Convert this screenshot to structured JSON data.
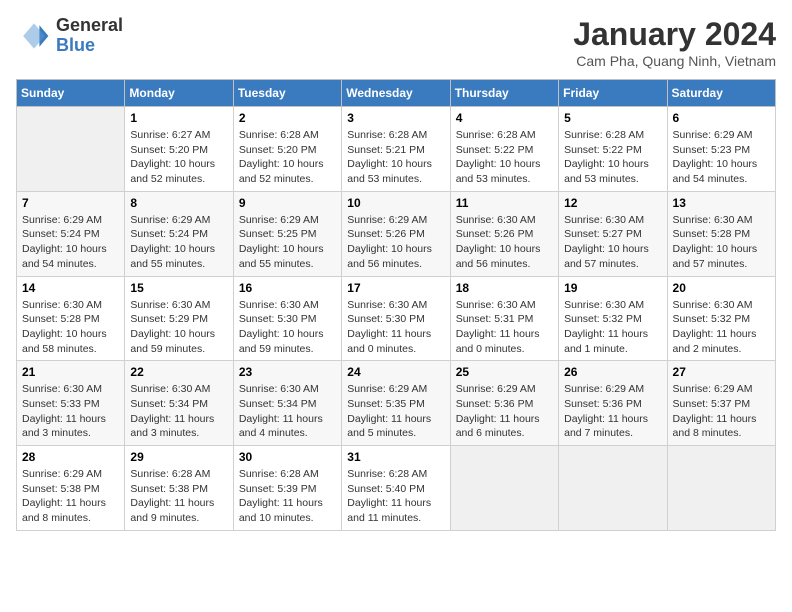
{
  "header": {
    "logo_text_general": "General",
    "logo_text_blue": "Blue",
    "month_title": "January 2024",
    "location": "Cam Pha, Quang Ninh, Vietnam"
  },
  "days_of_week": [
    "Sunday",
    "Monday",
    "Tuesday",
    "Wednesday",
    "Thursday",
    "Friday",
    "Saturday"
  ],
  "weeks": [
    [
      {
        "num": "",
        "info": ""
      },
      {
        "num": "1",
        "info": "Sunrise: 6:27 AM\nSunset: 5:20 PM\nDaylight: 10 hours\nand 52 minutes."
      },
      {
        "num": "2",
        "info": "Sunrise: 6:28 AM\nSunset: 5:20 PM\nDaylight: 10 hours\nand 52 minutes."
      },
      {
        "num": "3",
        "info": "Sunrise: 6:28 AM\nSunset: 5:21 PM\nDaylight: 10 hours\nand 53 minutes."
      },
      {
        "num": "4",
        "info": "Sunrise: 6:28 AM\nSunset: 5:22 PM\nDaylight: 10 hours\nand 53 minutes."
      },
      {
        "num": "5",
        "info": "Sunrise: 6:28 AM\nSunset: 5:22 PM\nDaylight: 10 hours\nand 53 minutes."
      },
      {
        "num": "6",
        "info": "Sunrise: 6:29 AM\nSunset: 5:23 PM\nDaylight: 10 hours\nand 54 minutes."
      }
    ],
    [
      {
        "num": "7",
        "info": "Sunrise: 6:29 AM\nSunset: 5:24 PM\nDaylight: 10 hours\nand 54 minutes."
      },
      {
        "num": "8",
        "info": "Sunrise: 6:29 AM\nSunset: 5:24 PM\nDaylight: 10 hours\nand 55 minutes."
      },
      {
        "num": "9",
        "info": "Sunrise: 6:29 AM\nSunset: 5:25 PM\nDaylight: 10 hours\nand 55 minutes."
      },
      {
        "num": "10",
        "info": "Sunrise: 6:29 AM\nSunset: 5:26 PM\nDaylight: 10 hours\nand 56 minutes."
      },
      {
        "num": "11",
        "info": "Sunrise: 6:30 AM\nSunset: 5:26 PM\nDaylight: 10 hours\nand 56 minutes."
      },
      {
        "num": "12",
        "info": "Sunrise: 6:30 AM\nSunset: 5:27 PM\nDaylight: 10 hours\nand 57 minutes."
      },
      {
        "num": "13",
        "info": "Sunrise: 6:30 AM\nSunset: 5:28 PM\nDaylight: 10 hours\nand 57 minutes."
      }
    ],
    [
      {
        "num": "14",
        "info": "Sunrise: 6:30 AM\nSunset: 5:28 PM\nDaylight: 10 hours\nand 58 minutes."
      },
      {
        "num": "15",
        "info": "Sunrise: 6:30 AM\nSunset: 5:29 PM\nDaylight: 10 hours\nand 59 minutes."
      },
      {
        "num": "16",
        "info": "Sunrise: 6:30 AM\nSunset: 5:30 PM\nDaylight: 10 hours\nand 59 minutes."
      },
      {
        "num": "17",
        "info": "Sunrise: 6:30 AM\nSunset: 5:30 PM\nDaylight: 11 hours\nand 0 minutes."
      },
      {
        "num": "18",
        "info": "Sunrise: 6:30 AM\nSunset: 5:31 PM\nDaylight: 11 hours\nand 0 minutes."
      },
      {
        "num": "19",
        "info": "Sunrise: 6:30 AM\nSunset: 5:32 PM\nDaylight: 11 hours\nand 1 minute."
      },
      {
        "num": "20",
        "info": "Sunrise: 6:30 AM\nSunset: 5:32 PM\nDaylight: 11 hours\nand 2 minutes."
      }
    ],
    [
      {
        "num": "21",
        "info": "Sunrise: 6:30 AM\nSunset: 5:33 PM\nDaylight: 11 hours\nand 3 minutes."
      },
      {
        "num": "22",
        "info": "Sunrise: 6:30 AM\nSunset: 5:34 PM\nDaylight: 11 hours\nand 3 minutes."
      },
      {
        "num": "23",
        "info": "Sunrise: 6:30 AM\nSunset: 5:34 PM\nDaylight: 11 hours\nand 4 minutes."
      },
      {
        "num": "24",
        "info": "Sunrise: 6:29 AM\nSunset: 5:35 PM\nDaylight: 11 hours\nand 5 minutes."
      },
      {
        "num": "25",
        "info": "Sunrise: 6:29 AM\nSunset: 5:36 PM\nDaylight: 11 hours\nand 6 minutes."
      },
      {
        "num": "26",
        "info": "Sunrise: 6:29 AM\nSunset: 5:36 PM\nDaylight: 11 hours\nand 7 minutes."
      },
      {
        "num": "27",
        "info": "Sunrise: 6:29 AM\nSunset: 5:37 PM\nDaylight: 11 hours\nand 8 minutes."
      }
    ],
    [
      {
        "num": "28",
        "info": "Sunrise: 6:29 AM\nSunset: 5:38 PM\nDaylight: 11 hours\nand 8 minutes."
      },
      {
        "num": "29",
        "info": "Sunrise: 6:28 AM\nSunset: 5:38 PM\nDaylight: 11 hours\nand 9 minutes."
      },
      {
        "num": "30",
        "info": "Sunrise: 6:28 AM\nSunset: 5:39 PM\nDaylight: 11 hours\nand 10 minutes."
      },
      {
        "num": "31",
        "info": "Sunrise: 6:28 AM\nSunset: 5:40 PM\nDaylight: 11 hours\nand 11 minutes."
      },
      {
        "num": "",
        "info": ""
      },
      {
        "num": "",
        "info": ""
      },
      {
        "num": "",
        "info": ""
      }
    ]
  ]
}
